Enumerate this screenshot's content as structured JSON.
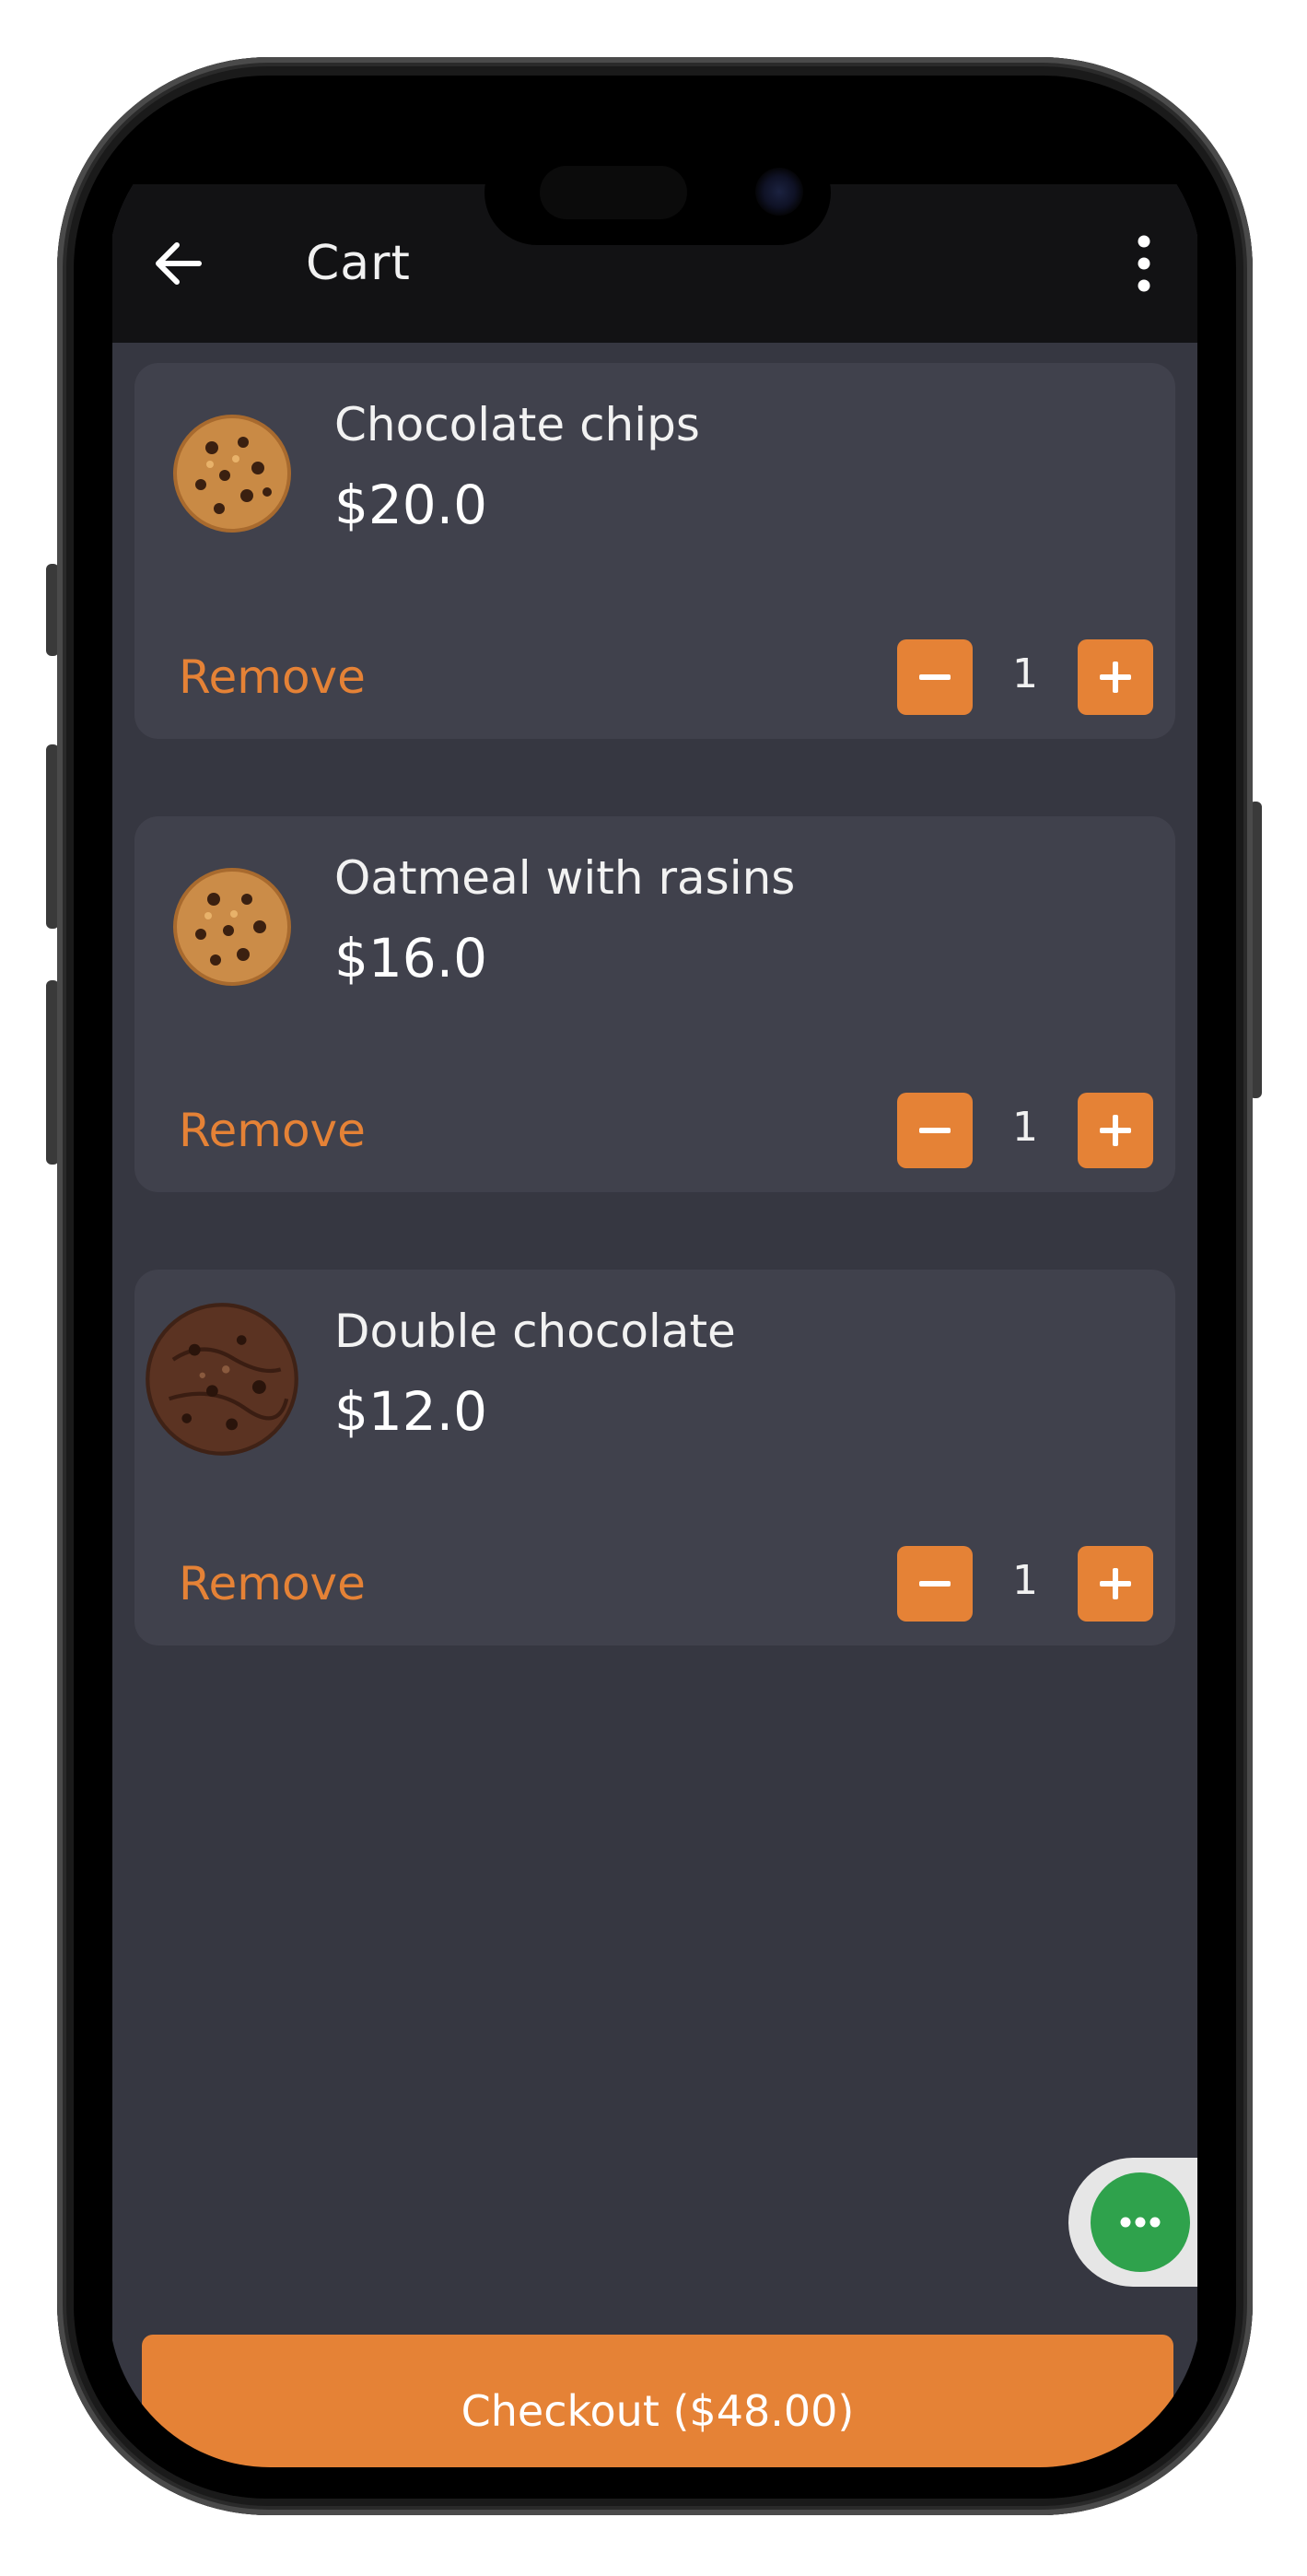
{
  "header": {
    "title": "Cart",
    "back_icon": "arrow-left-icon",
    "menu_icon": "more-vertical-icon"
  },
  "cart": {
    "items": [
      {
        "name": "Chocolate chips",
        "price": "$20.0",
        "quantity": "1",
        "remove_label": "Remove",
        "image": "cookie-light-image"
      },
      {
        "name": "Oatmeal with rasins",
        "price": "$16.0",
        "quantity": "1",
        "remove_label": "Remove",
        "image": "cookie-light-image"
      },
      {
        "name": "Double chocolate",
        "price": "$12.0",
        "quantity": "1",
        "remove_label": "Remove",
        "image": "cookie-dark-image"
      }
    ]
  },
  "checkout": {
    "label": "Checkout ($48.00)"
  },
  "fab": {
    "icon": "more-horizontal-icon"
  },
  "colors": {
    "accent": "#e58236",
    "background": "#363741",
    "card": "#40414c",
    "topbar": "#121214",
    "fab": "#2fa24c"
  }
}
